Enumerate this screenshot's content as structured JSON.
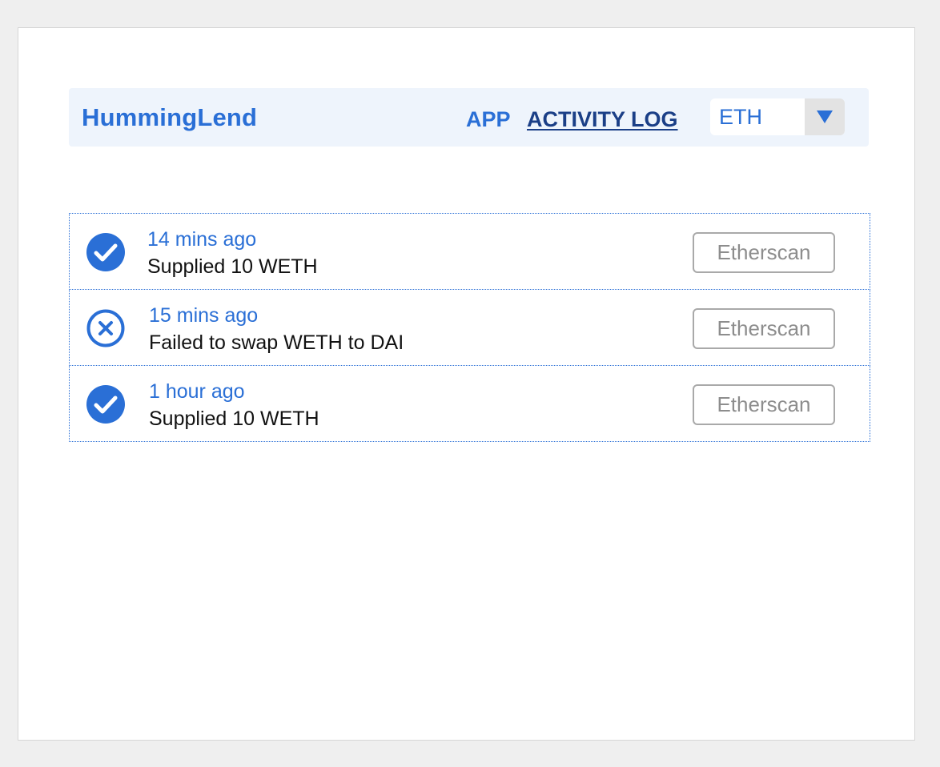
{
  "app": {
    "brand": "HummingLend"
  },
  "nav": {
    "app_label": "APP",
    "activity_label": "ACTIVITY LOG"
  },
  "network_select": {
    "value": "ETH"
  },
  "activity": [
    {
      "status": "success",
      "icon": "check-circle-icon",
      "time": "14 mins ago",
      "description": "Supplied 10 WETH",
      "button": "Etherscan"
    },
    {
      "status": "failed",
      "icon": "x-circle-icon",
      "time": "15 mins ago",
      "description": "Failed to swap WETH to DAI",
      "button": "Etherscan"
    },
    {
      "status": "success",
      "icon": "check-circle-icon",
      "time": "1 hour ago",
      "description": "Supplied 10 WETH",
      "button": "Etherscan"
    }
  ],
  "colors": {
    "accent": "#2a6fd6",
    "active_nav": "#1b3f87",
    "navbar_bg": "#eef4fc",
    "button_border": "#a9a9a9",
    "button_text": "#8d8d8d"
  }
}
